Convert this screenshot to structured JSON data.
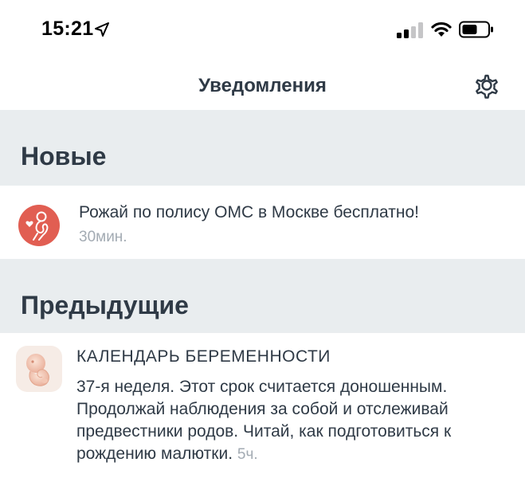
{
  "status_bar": {
    "time": "15:21",
    "icons": [
      "location-arrow-icon",
      "cellular-signal-icon",
      "wifi-icon",
      "battery-icon"
    ]
  },
  "nav": {
    "title": "Уведомления",
    "settings_icon": "gear-icon"
  },
  "sections": {
    "new": {
      "title": "Новые",
      "items": [
        {
          "icon": "pregnant-woman-heart-icon",
          "text": "Рожай по полису ОМС в Москве бесплатно!",
          "time": "30мин."
        }
      ]
    },
    "previous": {
      "title": "Предыдущие",
      "items": [
        {
          "icon": "fetus-icon",
          "heading": "КАЛЕНДАРЬ БЕРЕМЕННОСТИ",
          "text": "37-я неделя. Этот срок считается доношенным. Продолжай наблюдения за собой и отслеживай предвестники родов. Читай, как подготовиться к рождению малютки.",
          "time": "5ч."
        }
      ]
    }
  },
  "colors": {
    "section_bg": "#e9edef",
    "text": "#2f3a46",
    "muted": "#a3abb3",
    "accent_red": "#e15e52"
  }
}
